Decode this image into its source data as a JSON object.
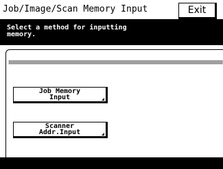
{
  "header": {
    "title": "Job/Image/Scan Memory Input",
    "exit_label": "Exit"
  },
  "message": {
    "text": "Select a method for inputting\nmemory."
  },
  "options": [
    {
      "label": "Job Memory\nInput"
    },
    {
      "label": "Scanner\nAddr.Input"
    }
  ],
  "colors": {
    "background": "#ffffff",
    "message_bar": "#000000",
    "footer": "#000000"
  }
}
